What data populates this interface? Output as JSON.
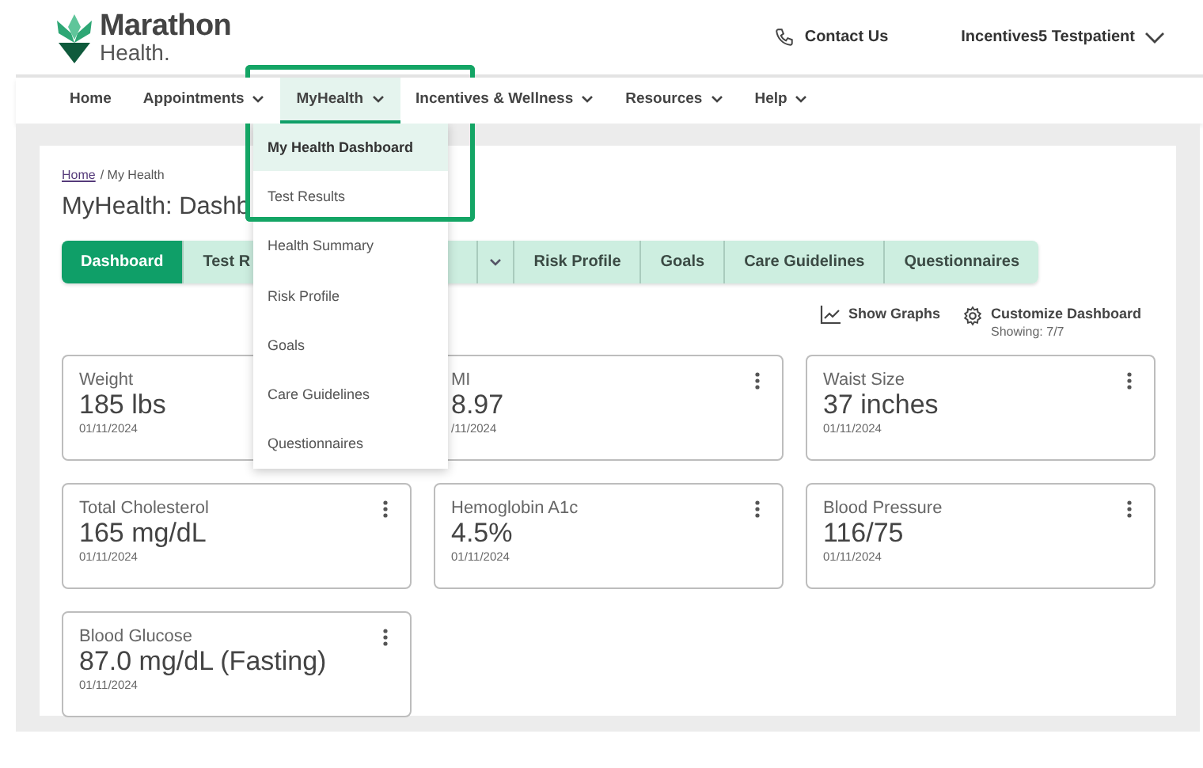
{
  "logo": {
    "name": "Marathon",
    "sub": "Health."
  },
  "header": {
    "contact": "Contact Us",
    "user": "Incentives5 Testpatient"
  },
  "nav": [
    {
      "label": "Home",
      "dropdown": false,
      "selected": false
    },
    {
      "label": "Appointments",
      "dropdown": true,
      "selected": false
    },
    {
      "label": "MyHealth",
      "dropdown": true,
      "selected": true
    },
    {
      "label": "Incentives & Wellness",
      "dropdown": true,
      "selected": false
    },
    {
      "label": "Resources",
      "dropdown": true,
      "selected": false
    },
    {
      "label": "Help",
      "dropdown": true,
      "selected": false
    }
  ],
  "menu": {
    "annotation_frame": true,
    "items": [
      {
        "label": "My Health Dashboard",
        "selected": true
      },
      {
        "label": "Test Results",
        "selected": false
      },
      {
        "label": "Health Summary",
        "selected": false
      },
      {
        "label": "Risk Profile",
        "selected": false
      },
      {
        "label": "Goals",
        "selected": false
      },
      {
        "label": "Care Guidelines",
        "selected": false
      },
      {
        "label": "Questionnaires",
        "selected": false
      }
    ]
  },
  "breadcrumb": {
    "link": "Home",
    "current": "/ My Health"
  },
  "title": "MyHealth: Dashb",
  "tabs": [
    {
      "kind": "text",
      "label": "Dashboard",
      "selected": true
    },
    {
      "kind": "covered",
      "label": "Test R",
      "selected": false
    },
    {
      "kind": "caret",
      "selected": false
    },
    {
      "kind": "text",
      "label": "Risk Profile",
      "selected": false
    },
    {
      "kind": "text",
      "label": "Goals",
      "selected": false
    },
    {
      "kind": "text",
      "label": "Care Guidelines",
      "selected": false
    },
    {
      "kind": "text",
      "label": "Questionnaires",
      "selected": false
    }
  ],
  "actions": {
    "graphs": "Show Graphs",
    "customize": "Customize Dashboard",
    "showing": "Showing: 7/7"
  },
  "cards": [
    {
      "label": "Weight",
      "value": "185 lbs",
      "date": "01/11/2024"
    },
    {
      "label": "MI",
      "value": "8.97",
      "date": "/11/2024",
      "menu": true
    },
    {
      "label": "Waist Size",
      "value": "37 inches",
      "date": "01/11/2024",
      "menu": true
    },
    {
      "label": "Total Cholesterol",
      "value": "165 mg/dL",
      "date": "01/11/2024",
      "menu": true
    },
    {
      "label": "Hemoglobin A1c",
      "value": "4.5%",
      "date": "01/11/2024",
      "menu": true
    },
    {
      "label": "Blood Pressure",
      "value": "116/75",
      "date": "01/11/2024",
      "menu": true
    },
    {
      "label": "Blood Glucose",
      "value": "87.0 mg/dL (Fasting)",
      "date": "01/11/2024",
      "menu": true
    }
  ]
}
